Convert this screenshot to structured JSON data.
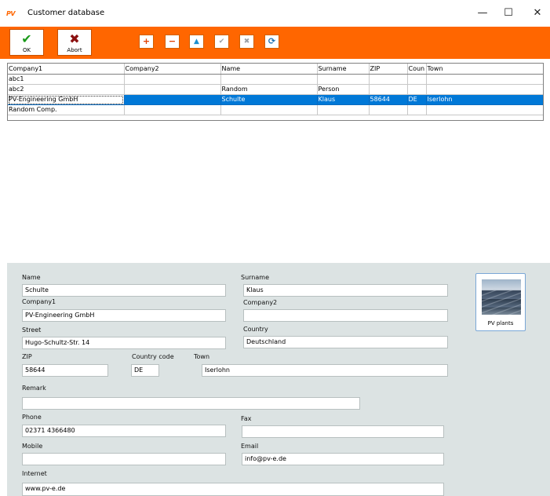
{
  "window": {
    "title": "Customer database",
    "logo": "PV"
  },
  "window_controls": {
    "minimize": "—",
    "maximize": "☐",
    "close": "✕"
  },
  "toolbar": {
    "ok_label": "OK",
    "abort_label": "Abort",
    "icons": [
      "plus-icon",
      "minus-icon",
      "up-arrow-icon",
      "check-icon",
      "x-icon",
      "refresh-icon"
    ]
  },
  "grid": {
    "columns": [
      "Company1",
      "Company2",
      "Name",
      "Surname",
      "ZIP",
      "Coun",
      "Town"
    ],
    "rows": [
      [
        "abc1",
        "",
        "",
        "",
        "",
        "",
        ""
      ],
      [
        "abc2",
        "",
        "Random",
        "Person",
        "",
        "",
        ""
      ],
      [
        "PV-Engineering GmbH",
        "",
        "Schulte",
        "Klaus",
        "58644",
        "DE",
        "Iserlohn"
      ],
      [
        "Random Comp.",
        "",
        "",
        "",
        "",
        "",
        ""
      ]
    ],
    "selected_row": 2
  },
  "form": {
    "name_label": "Name",
    "name_value": "Schulte",
    "surname_label": "Surname",
    "surname_value": "Klaus",
    "company1_label": "Company1",
    "company1_value": "PV-Engineering GmbH",
    "company2_label": "Company2",
    "company2_value": "",
    "street_label": "Street",
    "street_value": "Hugo-Schultz-Str. 14",
    "country_label": "Country",
    "country_value": "Deutschland",
    "zip_label": "ZIP",
    "zip_value": "58644",
    "country_code_label": "Country code",
    "country_code_value": "DE",
    "town_label": "Town",
    "town_value": "Iserlohn",
    "remark_label": "Remark",
    "remark_value": "",
    "phone_label": "Phone",
    "phone_value": "02371 4366480",
    "fax_label": "Fax",
    "fax_value": "",
    "mobile_label": "Mobile",
    "mobile_value": "",
    "email_label": "Email",
    "email_value": "info@pv-e.de",
    "internet_label": "Internet",
    "internet_value": "www.pv-e.de",
    "pv_button_label": "PV plants"
  },
  "colors": {
    "accent": "#ff6600",
    "selection": "#0078d7",
    "form_bg": "#dce3e3"
  }
}
